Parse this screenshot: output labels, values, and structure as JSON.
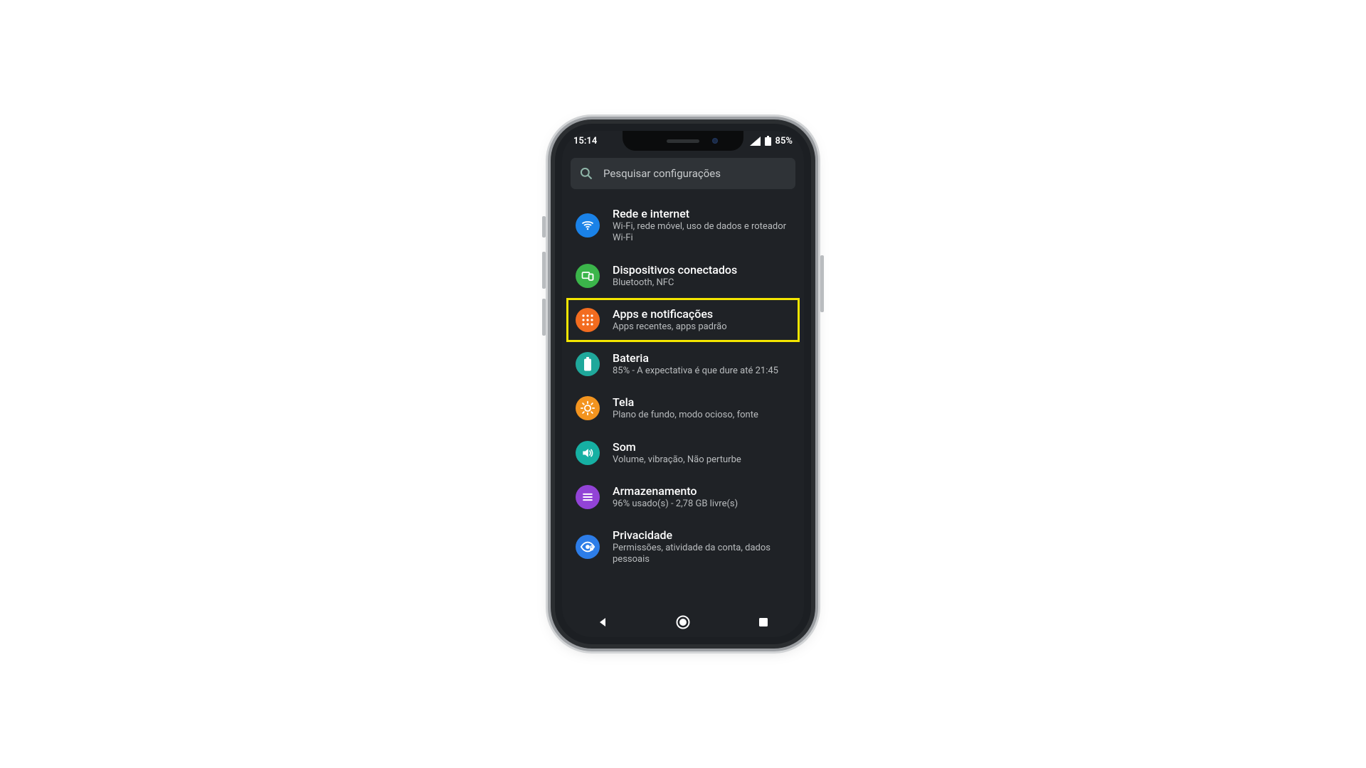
{
  "status": {
    "time": "15:14",
    "battery_text": "85%"
  },
  "search": {
    "placeholder": "Pesquisar configurações"
  },
  "rows": [
    {
      "title": "Rede e internet",
      "subtitle": "Wi-Fi, rede móvel, uso de dados e roteador Wi-Fi"
    },
    {
      "title": "Dispositivos conectados",
      "subtitle": "Bluetooth, NFC"
    },
    {
      "title": "Apps e notificações",
      "subtitle": "Apps recentes, apps padrão"
    },
    {
      "title": "Bateria",
      "subtitle": "85% - A expectativa é que dure até 21:45"
    },
    {
      "title": "Tela",
      "subtitle": "Plano de fundo, modo ocioso, fonte"
    },
    {
      "title": "Som",
      "subtitle": "Volume, vibração, Não perturbe"
    },
    {
      "title": "Armazenamento",
      "subtitle": "96% usado(s) - 2,78 GB livre(s)"
    },
    {
      "title": "Privacidade",
      "subtitle": "Permissões, atividade da conta, dados pessoais"
    }
  ],
  "highlight_index": 2
}
